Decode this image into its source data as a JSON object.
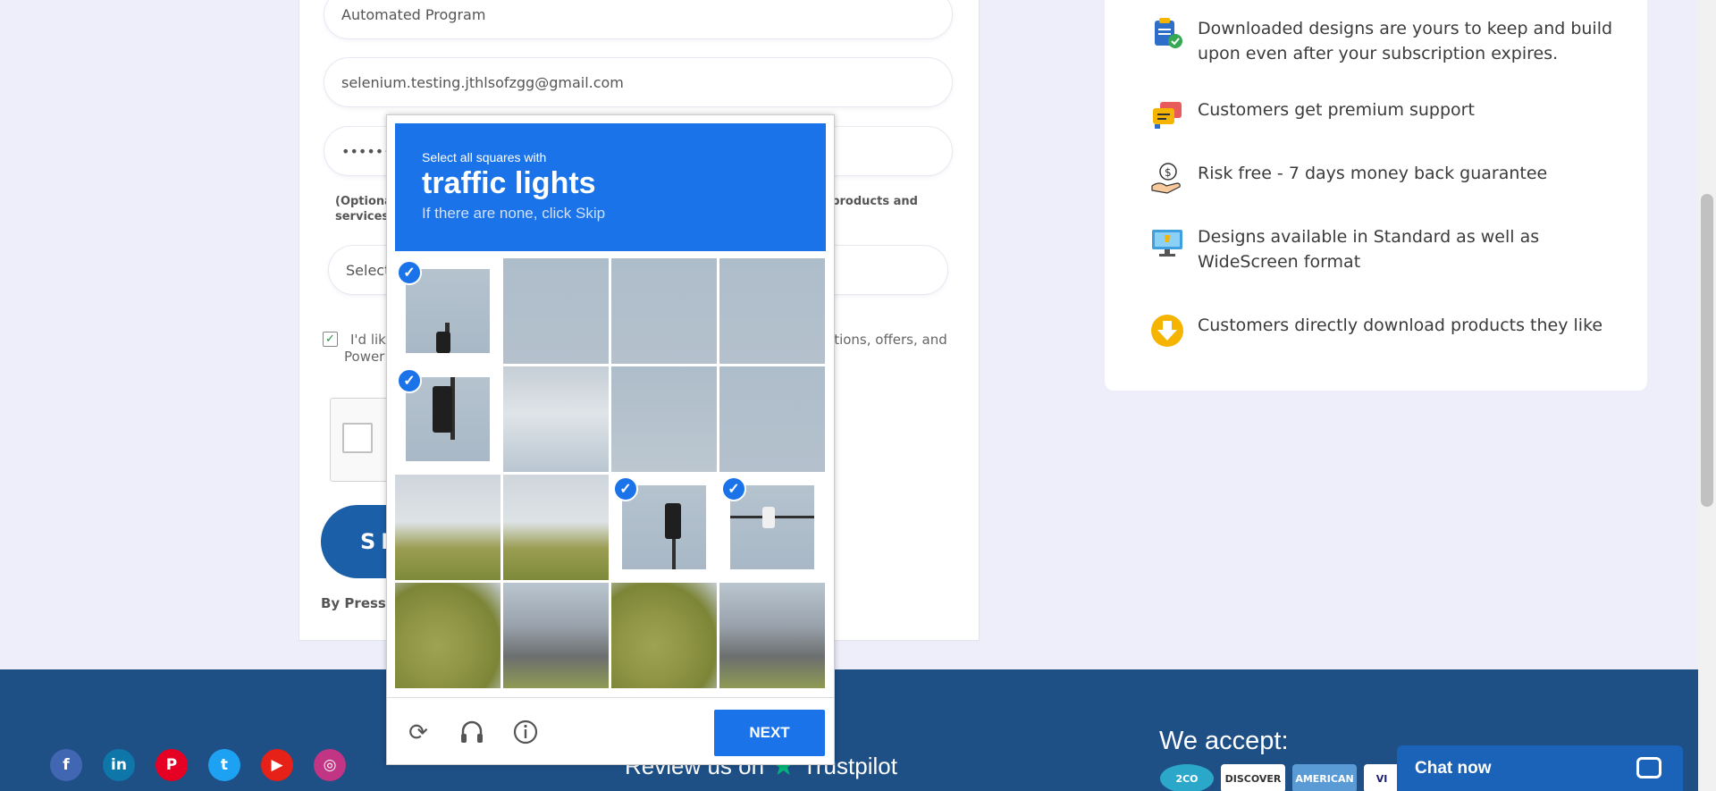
{
  "form": {
    "name_value": "Automated Program",
    "email_value": "selenium.testing.jthlsofzgg@gmail.com",
    "password_value": "••••••••••",
    "optional_note_left": "(Optiona",
    "optional_note_left2": "services.",
    "optional_note_right": "ur products and",
    "select_value": "Select",
    "newsletter_checked": true,
    "newsletter_text_start": "I'd lik",
    "newsletter_text_end": "ations, offers, and",
    "newsletter_text_line2": "Power",
    "signup_label": "SI",
    "by_pressing": "By Pressi"
  },
  "benefits": {
    "items": [
      {
        "icon": "clipboard-check-icon",
        "text": "Downloaded designs are yours to keep and build upon even after your subscription expires."
      },
      {
        "icon": "chat-bubbles-icon",
        "text": "Customers get premium support"
      },
      {
        "icon": "money-hand-icon",
        "text": "Risk free - 7 days money back guarantee"
      },
      {
        "icon": "monitor-icon",
        "text": "Designs available in Standard as well as WideScreen format"
      },
      {
        "icon": "download-arrow-icon",
        "text": "Customers directly download products they like"
      }
    ]
  },
  "captcha": {
    "instruction_small": "Select all squares with",
    "instruction_big": "traffic lights",
    "instruction_hint": "If there are none, click Skip",
    "next_label": "NEXT",
    "tiles": [
      {
        "selected": true
      },
      {
        "selected": false
      },
      {
        "selected": false
      },
      {
        "selected": false
      },
      {
        "selected": true
      },
      {
        "selected": false
      },
      {
        "selected": false
      },
      {
        "selected": false
      },
      {
        "selected": false
      },
      {
        "selected": false
      },
      {
        "selected": true
      },
      {
        "selected": true
      },
      {
        "selected": false
      },
      {
        "selected": false
      },
      {
        "selected": false
      },
      {
        "selected": false
      }
    ]
  },
  "footer": {
    "review_text": "Review us on",
    "review_brand": "Trustpilot",
    "accept_title": "We accept:",
    "cards": [
      "2CO",
      "DISCOVER",
      "AMERICAN",
      "VI"
    ],
    "chat_label": "Chat now",
    "social": [
      {
        "name": "facebook-icon",
        "glyph": "f",
        "color": "#3b5998"
      },
      {
        "name": "linkedin-icon",
        "glyph": "in",
        "color": "#0e76a8"
      },
      {
        "name": "pinterest-icon",
        "glyph": "P",
        "color": "#e60023"
      },
      {
        "name": "twitter-icon",
        "glyph": "t",
        "color": "#1da1f2"
      },
      {
        "name": "youtube-icon",
        "glyph": "▶",
        "color": "#e62117"
      },
      {
        "name": "instagram-icon",
        "glyph": "◎",
        "color": "#c13584"
      }
    ]
  }
}
